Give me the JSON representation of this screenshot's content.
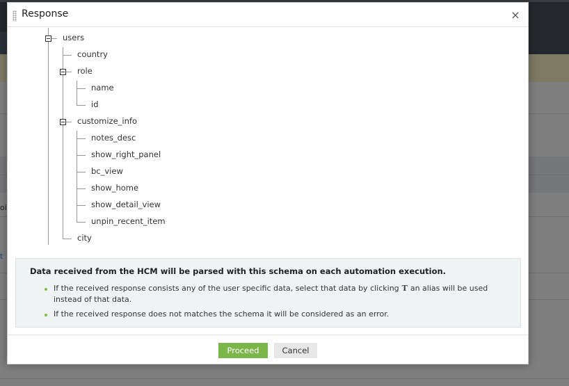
{
  "dialog": {
    "title": "Response",
    "close_icon": "×",
    "tree": [
      {
        "label": "users",
        "depth": 0,
        "expandable": true
      },
      {
        "label": "country",
        "depth": 1
      },
      {
        "label": "role",
        "depth": 1,
        "expandable": true
      },
      {
        "label": "name",
        "depth": 2
      },
      {
        "label": "id",
        "depth": 2
      },
      {
        "label": "customize_info",
        "depth": 1,
        "expandable": true
      },
      {
        "label": "notes_desc",
        "depth": 2
      },
      {
        "label": "show_right_panel",
        "depth": 2
      },
      {
        "label": "bc_view",
        "depth": 2
      },
      {
        "label": "show_home",
        "depth": 2
      },
      {
        "label": "show_detail_view",
        "depth": 2
      },
      {
        "label": "unpin_recent_item",
        "depth": 2
      },
      {
        "label": "city",
        "depth": 1
      }
    ],
    "info": {
      "heading": "Data received from the HCM will be parsed with this schema on each automation execution.",
      "bullet1_before": "If the received response consists any of the user specific data, select that data by clicking",
      "alias_icon": "T",
      "bullet1_after": "an alias will be used instead of that data.",
      "bullet2": "If the received response does not matches the schema it will be considered as an error."
    },
    "buttons": {
      "proceed": "Proceed",
      "cancel": "Cancel"
    }
  },
  "background": {
    "fragment1": "ois",
    "fragment2": "t"
  },
  "colors": {
    "accent": "#7ab648",
    "info_bg": "#eff3f3"
  }
}
